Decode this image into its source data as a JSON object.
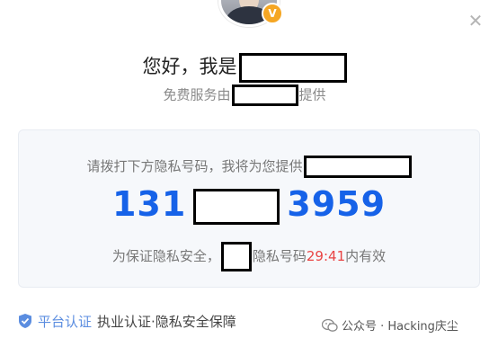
{
  "greeting": {
    "prefix": "您好，我是"
  },
  "provider": {
    "prefix": "免费服务由",
    "suffix": "提供"
  },
  "card": {
    "instruction": "请拨打下方隐私号码，我将为您提供",
    "phone_prefix": "131",
    "phone_suffix": "3959",
    "notice_prefix": "为保证隐私安全，",
    "notice_middle": "隐私号码",
    "timer": "29:41",
    "notice_suffix": "内有效"
  },
  "footer": {
    "platform_label": "平台认证",
    "guarantee_text": "执业认证·隐私安全保障"
  },
  "watermark": {
    "text": "公众号 · Hacking庆尘"
  },
  "badge": {
    "symbol": "V"
  },
  "close": {
    "symbol": "✕"
  },
  "colors": {
    "accent": "#1662e8",
    "timer": "#e94343",
    "badge": "#f5a623"
  }
}
